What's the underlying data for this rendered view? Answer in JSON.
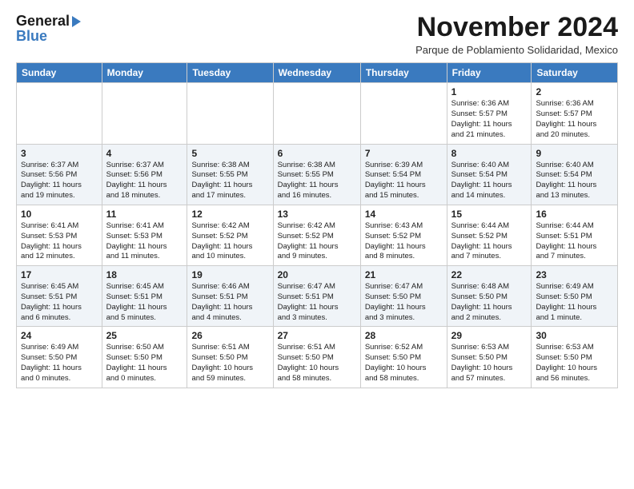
{
  "logo": {
    "line1": "General",
    "line2": "Blue"
  },
  "title": "November 2024",
  "subtitle": "Parque de Poblamiento Solidaridad, Mexico",
  "weekdays": [
    "Sunday",
    "Monday",
    "Tuesday",
    "Wednesday",
    "Thursday",
    "Friday",
    "Saturday"
  ],
  "weeks": [
    [
      {
        "day": "",
        "info": ""
      },
      {
        "day": "",
        "info": ""
      },
      {
        "day": "",
        "info": ""
      },
      {
        "day": "",
        "info": ""
      },
      {
        "day": "",
        "info": ""
      },
      {
        "day": "1",
        "info": "Sunrise: 6:36 AM\nSunset: 5:57 PM\nDaylight: 11 hours\nand 21 minutes."
      },
      {
        "day": "2",
        "info": "Sunrise: 6:36 AM\nSunset: 5:57 PM\nDaylight: 11 hours\nand 20 minutes."
      }
    ],
    [
      {
        "day": "3",
        "info": "Sunrise: 6:37 AM\nSunset: 5:56 PM\nDaylight: 11 hours\nand 19 minutes."
      },
      {
        "day": "4",
        "info": "Sunrise: 6:37 AM\nSunset: 5:56 PM\nDaylight: 11 hours\nand 18 minutes."
      },
      {
        "day": "5",
        "info": "Sunrise: 6:38 AM\nSunset: 5:55 PM\nDaylight: 11 hours\nand 17 minutes."
      },
      {
        "day": "6",
        "info": "Sunrise: 6:38 AM\nSunset: 5:55 PM\nDaylight: 11 hours\nand 16 minutes."
      },
      {
        "day": "7",
        "info": "Sunrise: 6:39 AM\nSunset: 5:54 PM\nDaylight: 11 hours\nand 15 minutes."
      },
      {
        "day": "8",
        "info": "Sunrise: 6:40 AM\nSunset: 5:54 PM\nDaylight: 11 hours\nand 14 minutes."
      },
      {
        "day": "9",
        "info": "Sunrise: 6:40 AM\nSunset: 5:54 PM\nDaylight: 11 hours\nand 13 minutes."
      }
    ],
    [
      {
        "day": "10",
        "info": "Sunrise: 6:41 AM\nSunset: 5:53 PM\nDaylight: 11 hours\nand 12 minutes."
      },
      {
        "day": "11",
        "info": "Sunrise: 6:41 AM\nSunset: 5:53 PM\nDaylight: 11 hours\nand 11 minutes."
      },
      {
        "day": "12",
        "info": "Sunrise: 6:42 AM\nSunset: 5:52 PM\nDaylight: 11 hours\nand 10 minutes."
      },
      {
        "day": "13",
        "info": "Sunrise: 6:42 AM\nSunset: 5:52 PM\nDaylight: 11 hours\nand 9 minutes."
      },
      {
        "day": "14",
        "info": "Sunrise: 6:43 AM\nSunset: 5:52 PM\nDaylight: 11 hours\nand 8 minutes."
      },
      {
        "day": "15",
        "info": "Sunrise: 6:44 AM\nSunset: 5:52 PM\nDaylight: 11 hours\nand 7 minutes."
      },
      {
        "day": "16",
        "info": "Sunrise: 6:44 AM\nSunset: 5:51 PM\nDaylight: 11 hours\nand 7 minutes."
      }
    ],
    [
      {
        "day": "17",
        "info": "Sunrise: 6:45 AM\nSunset: 5:51 PM\nDaylight: 11 hours\nand 6 minutes."
      },
      {
        "day": "18",
        "info": "Sunrise: 6:45 AM\nSunset: 5:51 PM\nDaylight: 11 hours\nand 5 minutes."
      },
      {
        "day": "19",
        "info": "Sunrise: 6:46 AM\nSunset: 5:51 PM\nDaylight: 11 hours\nand 4 minutes."
      },
      {
        "day": "20",
        "info": "Sunrise: 6:47 AM\nSunset: 5:51 PM\nDaylight: 11 hours\nand 3 minutes."
      },
      {
        "day": "21",
        "info": "Sunrise: 6:47 AM\nSunset: 5:50 PM\nDaylight: 11 hours\nand 3 minutes."
      },
      {
        "day": "22",
        "info": "Sunrise: 6:48 AM\nSunset: 5:50 PM\nDaylight: 11 hours\nand 2 minutes."
      },
      {
        "day": "23",
        "info": "Sunrise: 6:49 AM\nSunset: 5:50 PM\nDaylight: 11 hours\nand 1 minute."
      }
    ],
    [
      {
        "day": "24",
        "info": "Sunrise: 6:49 AM\nSunset: 5:50 PM\nDaylight: 11 hours\nand 0 minutes."
      },
      {
        "day": "25",
        "info": "Sunrise: 6:50 AM\nSunset: 5:50 PM\nDaylight: 11 hours\nand 0 minutes."
      },
      {
        "day": "26",
        "info": "Sunrise: 6:51 AM\nSunset: 5:50 PM\nDaylight: 10 hours\nand 59 minutes."
      },
      {
        "day": "27",
        "info": "Sunrise: 6:51 AM\nSunset: 5:50 PM\nDaylight: 10 hours\nand 58 minutes."
      },
      {
        "day": "28",
        "info": "Sunrise: 6:52 AM\nSunset: 5:50 PM\nDaylight: 10 hours\nand 58 minutes."
      },
      {
        "day": "29",
        "info": "Sunrise: 6:53 AM\nSunset: 5:50 PM\nDaylight: 10 hours\nand 57 minutes."
      },
      {
        "day": "30",
        "info": "Sunrise: 6:53 AM\nSunset: 5:50 PM\nDaylight: 10 hours\nand 56 minutes."
      }
    ]
  ]
}
